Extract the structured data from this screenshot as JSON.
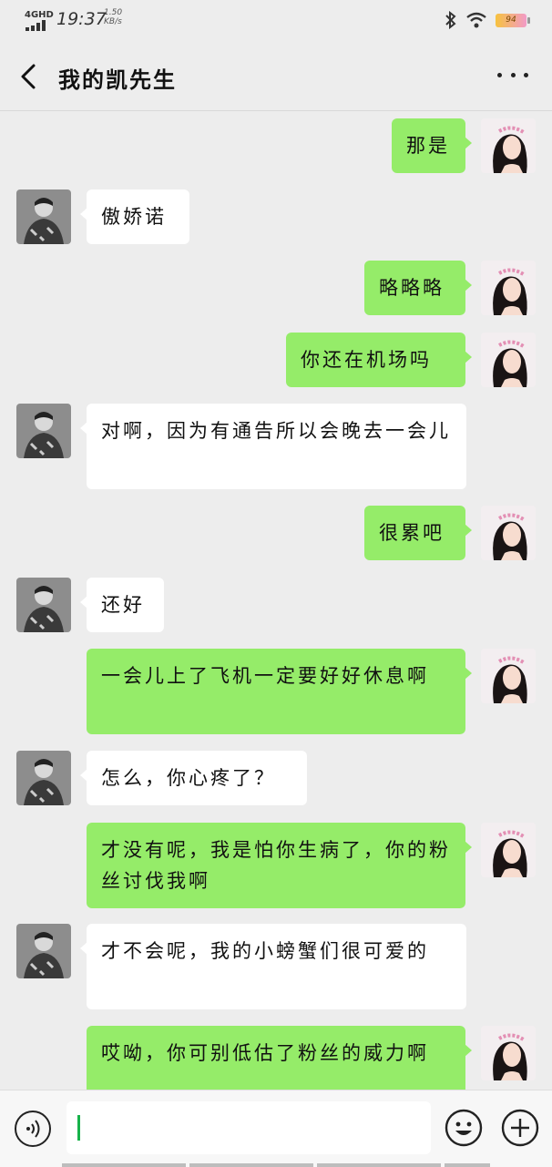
{
  "status_bar": {
    "network": "4GHD",
    "time": "19:37",
    "speed_top": "1.50",
    "speed_bottom": "KB/s",
    "battery": "94",
    "icons": [
      "signal-icon",
      "bluetooth-icon",
      "wifi-icon",
      "battery-icon"
    ]
  },
  "header": {
    "title": "我的凯先生",
    "back_icon": "chevron-left-icon",
    "more_icon": "more-dots-icon"
  },
  "messages": [
    {
      "side": "out",
      "text": "那是"
    },
    {
      "side": "in",
      "text": "傲娇诺"
    },
    {
      "side": "out",
      "text": "略略略"
    },
    {
      "side": "out",
      "text": "你还在机场吗"
    },
    {
      "side": "in",
      "text": "对啊，因为有通告所以会晚去一会儿"
    },
    {
      "side": "out",
      "text": "很累吧"
    },
    {
      "side": "in",
      "text": "还好"
    },
    {
      "side": "out",
      "text": "一会儿上了飞机一定要好好休息啊"
    },
    {
      "side": "in",
      "text": "怎么，你心疼了？"
    },
    {
      "side": "out",
      "text": "才没有呢，我是怕你生病了，你的粉丝讨伐我啊"
    },
    {
      "side": "in",
      "text": "才不会呢，我的小螃蟹们很可爱的"
    },
    {
      "side": "out",
      "text": "哎呦，你可别低估了粉丝的威力啊"
    }
  ],
  "input_bar": {
    "text_value": "",
    "voice_icon": "voice-icon",
    "emoji_icon": "emoji-icon",
    "plus_icon": "plus-icon"
  },
  "colors": {
    "background": "#ededed",
    "incoming_bubble": "#ffffff",
    "outgoing_bubble": "#95ec69",
    "caret": "#17b24a"
  }
}
